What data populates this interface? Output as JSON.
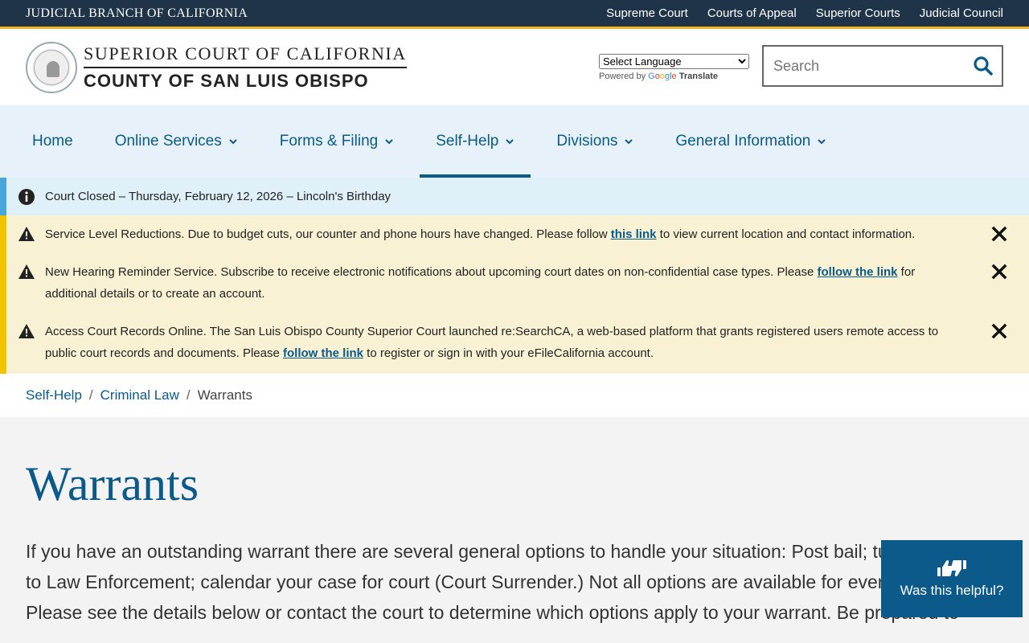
{
  "topbar": {
    "branch": "JUDICIAL BRANCH OF CALIFORNIA",
    "links": [
      "Supreme Court",
      "Courts of Appeal",
      "Superior Courts",
      "Judicial Council"
    ]
  },
  "header": {
    "line1": "SUPERIOR COURT OF CALIFORNIA",
    "line2": "COUNTY OF SAN LUIS OBISPO",
    "language_select": "Select Language",
    "powered_by": "Powered by",
    "google_letters": [
      "G",
      "o",
      "o",
      "g",
      "l",
      "e"
    ],
    "translate": "Translate",
    "search_placeholder": "Search"
  },
  "nav": {
    "items": [
      {
        "label": "Home",
        "dropdown": false
      },
      {
        "label": "Online Services",
        "dropdown": true
      },
      {
        "label": "Forms & Filing",
        "dropdown": true
      },
      {
        "label": "Self-Help",
        "dropdown": true,
        "active": true
      },
      {
        "label": "Divisions",
        "dropdown": true
      },
      {
        "label": "General Information",
        "dropdown": true
      }
    ]
  },
  "alerts": {
    "info": "Court Closed – Thursday, February 12, 2026 – Lincoln's Birthday",
    "warnings": [
      {
        "before": "Service Level Reductions. Due to budget cuts, our counter and phone hours have changed. Please follow ",
        "link": "this link",
        "after": " to view current location and contact information."
      },
      {
        "before": "New Hearing Reminder Service. Subscribe to receive electronic notifications about upcoming court dates on non-confidential case types. Please ",
        "link": "follow the link",
        "after": " for additional details or to create an account."
      },
      {
        "before": "Access Court Records Online. The San Luis Obispo County Superior Court launched re:SearchCA, a web-based platform that grants registered users remote access to public court records and documents. Please ",
        "link": "follow the link",
        "after": " to register or sign in with your eFileCalifornia account."
      }
    ]
  },
  "breadcrumb": {
    "items": [
      "Self-Help",
      "Criminal Law"
    ],
    "separator": "/",
    "current": "Warrants"
  },
  "content": {
    "title": "Warrants",
    "intro": "If you have an outstanding warrant there are several general options to handle your situation: Post bail; turn yourself in to Law Enforcement; calendar your case for court (Court Surrender.) Not all options are available for every warrant. Please see the details below or contact the court to determine which options apply to your warrant. Be prepared to"
  },
  "feedback": {
    "label": "Was this helpful?"
  },
  "colors": {
    "topbar": "#1f3448",
    "gold": "#f0b323",
    "link_blue": "#0b5a8a",
    "nav_bg": "#e6f1f9",
    "info_bg": "#dff0f8",
    "warning_bg": "#f8f1d3"
  }
}
